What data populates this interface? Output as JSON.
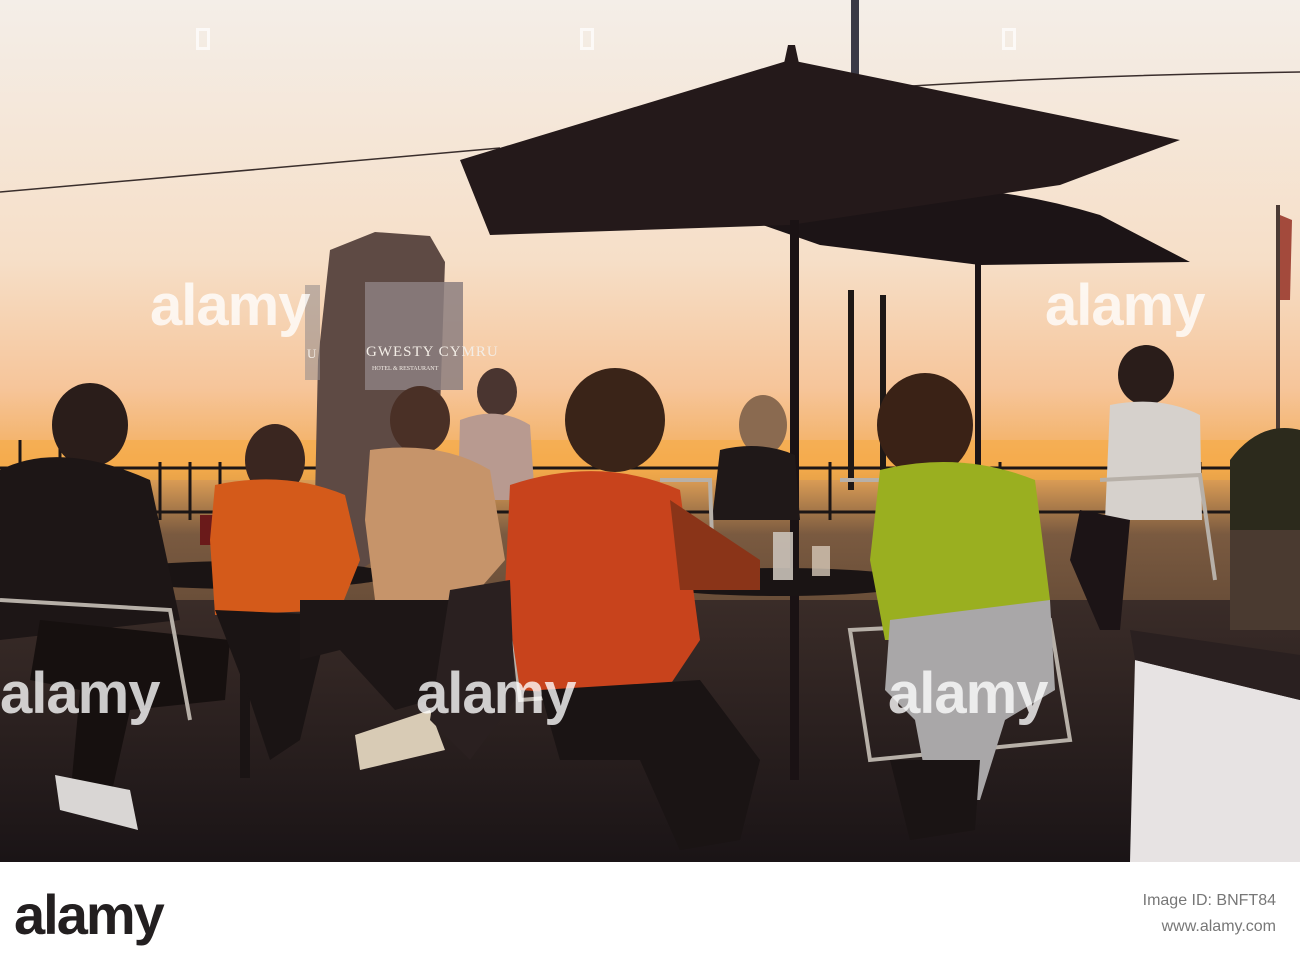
{
  "watermark": {
    "text": "alamy"
  },
  "sign": {
    "line1": "GWESTY CYMRU",
    "line2": "HOTEL & RESTAURANT",
    "partial": "U"
  },
  "footer": {
    "brand": "alamy",
    "image_id": "Image ID: BNFT84",
    "url": "www.alamy.com"
  },
  "colors": {
    "sky_top": "#f7f0e8",
    "sky_mid": "#f8c79a",
    "sky_horizon": "#f2a43a",
    "silhouette": "#1a1412",
    "umbrella": "#24191a",
    "red_shirt": "#c9441f",
    "green_jumper": "#9bb021",
    "orange_hoodie": "#e0651c"
  }
}
